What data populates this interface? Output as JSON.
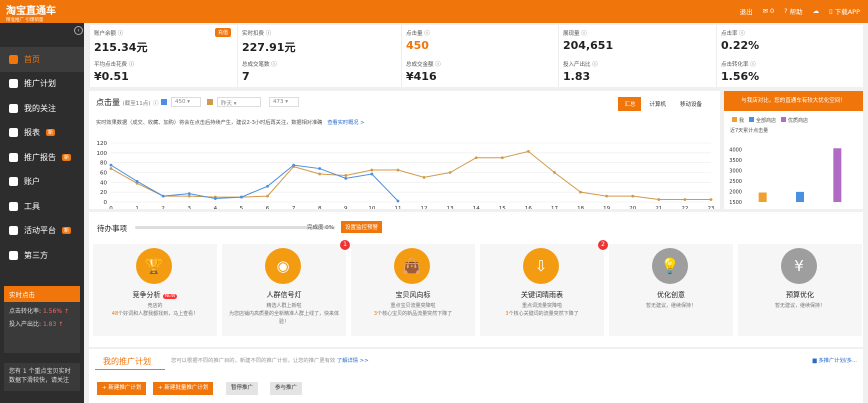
{
  "app": {
    "logo_title": "淘宝直通车",
    "logo_sub": "精准推广 引爆销量",
    "top_nav": [
      "退出",
      "0",
      "帮助",
      "下载APP"
    ]
  },
  "sidebar": {
    "items": [
      {
        "label": "首页",
        "badge": "",
        "icon": "home-icon",
        "active": true
      },
      {
        "label": "推广计划",
        "badge": "",
        "icon": "folder-icon",
        "active": false
      },
      {
        "label": "我的关注",
        "badge": "",
        "icon": "heart-icon",
        "active": false
      },
      {
        "label": "报表",
        "badge": "新",
        "icon": "report-icon",
        "active": false
      },
      {
        "label": "推广报告",
        "badge": "新",
        "icon": "document-icon",
        "active": false
      },
      {
        "label": "账户",
        "badge": "",
        "icon": "user-icon",
        "active": false
      },
      {
        "label": "工具",
        "badge": "",
        "icon": "tool-icon",
        "active": false
      },
      {
        "label": "活动平台",
        "badge": "新",
        "icon": "gift-icon",
        "active": false
      },
      {
        "label": "第三方",
        "badge": "",
        "icon": "diamond-icon",
        "active": false
      }
    ],
    "realtime": {
      "title": "实时点击",
      "row1_label": "点击转化率",
      "row1_value": "1.56%",
      "row2_label": "投入产出比",
      "row2_value": "1.83"
    },
    "note": "您有 1 个重点宝贝实时数据下滑较快，请关注"
  },
  "stats": [
    {
      "label": "账户余额",
      "value": "215.34元",
      "tag": "充值",
      "orange": false
    },
    {
      "label": "实时扣费",
      "value": "227.91元",
      "tag": "",
      "orange": false
    },
    {
      "label": "点击量",
      "value": "450",
      "tag": "",
      "orange": true
    },
    {
      "label": "展现量",
      "value": "204,651",
      "tag": "",
      "orange": false
    },
    {
      "label": "点击率",
      "value": "0.22%",
      "tag": "",
      "orange": false
    },
    {
      "label": "平均点击花费",
      "value": "¥0.51",
      "tag": "",
      "orange": false
    },
    {
      "label": "总成交笔数",
      "value": "7",
      "tag": "",
      "orange": false
    },
    {
      "label": "总成交金额",
      "value": "¥416",
      "tag": "",
      "orange": false
    },
    {
      "label": "投入产出比",
      "value": "1.83",
      "tag": "",
      "orange": false
    },
    {
      "label": "点击转化率",
      "value": "1.56%",
      "tag": "",
      "orange": false
    }
  ],
  "chart_panel": {
    "title": "点击量",
    "subtitle": "(截至11点)",
    "select1": "450",
    "select2": "昨天",
    "select3": "473",
    "tabs": [
      "汇总",
      "计算机",
      "移动设备"
    ],
    "note": "实时效果数据（成交、收藏、加购）将会在点击后持续产生，建议2-3小时后再关注，数据相对准确",
    "note_link": "查看实时概况 >"
  },
  "chart_data": {
    "type": "line",
    "x": [
      0,
      1,
      2,
      3,
      4,
      5,
      6,
      7,
      8,
      9,
      10,
      11,
      12,
      13,
      14,
      15,
      16,
      17,
      18,
      19,
      20,
      21,
      22,
      23
    ],
    "y_ticks": [
      0,
      20,
      40,
      60,
      80,
      100,
      120
    ],
    "ylim": [
      0,
      120
    ],
    "series": [
      {
        "name": "",
        "color": "#4a8fe0",
        "values": [
          75,
          42,
          12,
          17,
          7,
          10,
          32,
          75,
          68,
          48,
          57,
          2
        ]
      },
      {
        "name": "",
        "color": "#d19a4c",
        "values": [
          68,
          38,
          12,
          12,
          10,
          10,
          12,
          72,
          57,
          54,
          65,
          65,
          50,
          60,
          90,
          90,
          103,
          60,
          20,
          12,
          12,
          5,
          5,
          5
        ]
      }
    ]
  },
  "right_panel": {
    "button": "与我店对比，您的直通车有较大优化空间！",
    "legend": [
      "我",
      "全部商店",
      "优质商店"
    ],
    "subtitle": "近7天累计点击量",
    "chart_data": {
      "type": "bar",
      "categories": [
        "我",
        "全部商店",
        "优质商店"
      ],
      "values": [
        1950,
        1980,
        4050
      ],
      "y_ticks": [
        1500,
        2000,
        2500,
        3000,
        3500,
        4000
      ],
      "ylim": [
        1500,
        4300
      ],
      "colors": [
        "#f0a030",
        "#4a8fe0",
        "#b06cc4"
      ]
    }
  },
  "todo": {
    "title": "待办事项",
    "progress_label": "完成度 0%",
    "progress": 0,
    "button": "设置监控预警",
    "cards": [
      {
        "name": "竞争分析",
        "new": "NEW",
        "desc": "竞店的",
        "desc2": "48",
        "desc3": "个好词和人群我都找到，马上查看！",
        "icon": "trophy-icon",
        "gray": false,
        "badge": ""
      },
      {
        "name": "人群信号灯",
        "new": "",
        "desc": "精选人群上新啦",
        "desc2": "",
        "desc3": "为您店铺内高质量的全新精准人群上线了，快来体验！",
        "icon": "signal-icon",
        "gray": false,
        "badge": "1"
      },
      {
        "name": "宝贝风向标",
        "new": "",
        "desc": "重点宝贝流量突降啦",
        "desc2": "3",
        "desc3": "个核心宝贝的新品流量突然下降了",
        "icon": "shopping-bag-icon",
        "gray": false,
        "badge": ""
      },
      {
        "name": "关键词晴雨表",
        "new": "",
        "desc": "重点词流量突降啦",
        "desc2": "3",
        "desc3": "个核心关键词的流量突然下降了",
        "icon": "download-icon",
        "gray": false,
        "badge": "2"
      },
      {
        "name": "优化创意",
        "new": "",
        "desc": "暂无建议，继续保持！",
        "desc2": "",
        "desc3": "",
        "icon": "lightbulb-icon",
        "gray": true,
        "badge": ""
      },
      {
        "name": "预算优化",
        "new": "",
        "desc": "暂无建议，继续保持！",
        "desc2": "",
        "desc3": "",
        "icon": "budget-icon",
        "gray": true,
        "badge": ""
      }
    ]
  },
  "plans": {
    "tab": "我的推广计划",
    "desc": "您可以根据不同的推广目的，新建不同的推广计划，让您的推广更有效",
    "link": "了解详情 >>",
    "right": "多推广计划/多...",
    "buttons": [
      "+ 新建推广计划",
      "+ 新建批量推广计划",
      "暂停推广",
      "参与推广"
    ]
  }
}
